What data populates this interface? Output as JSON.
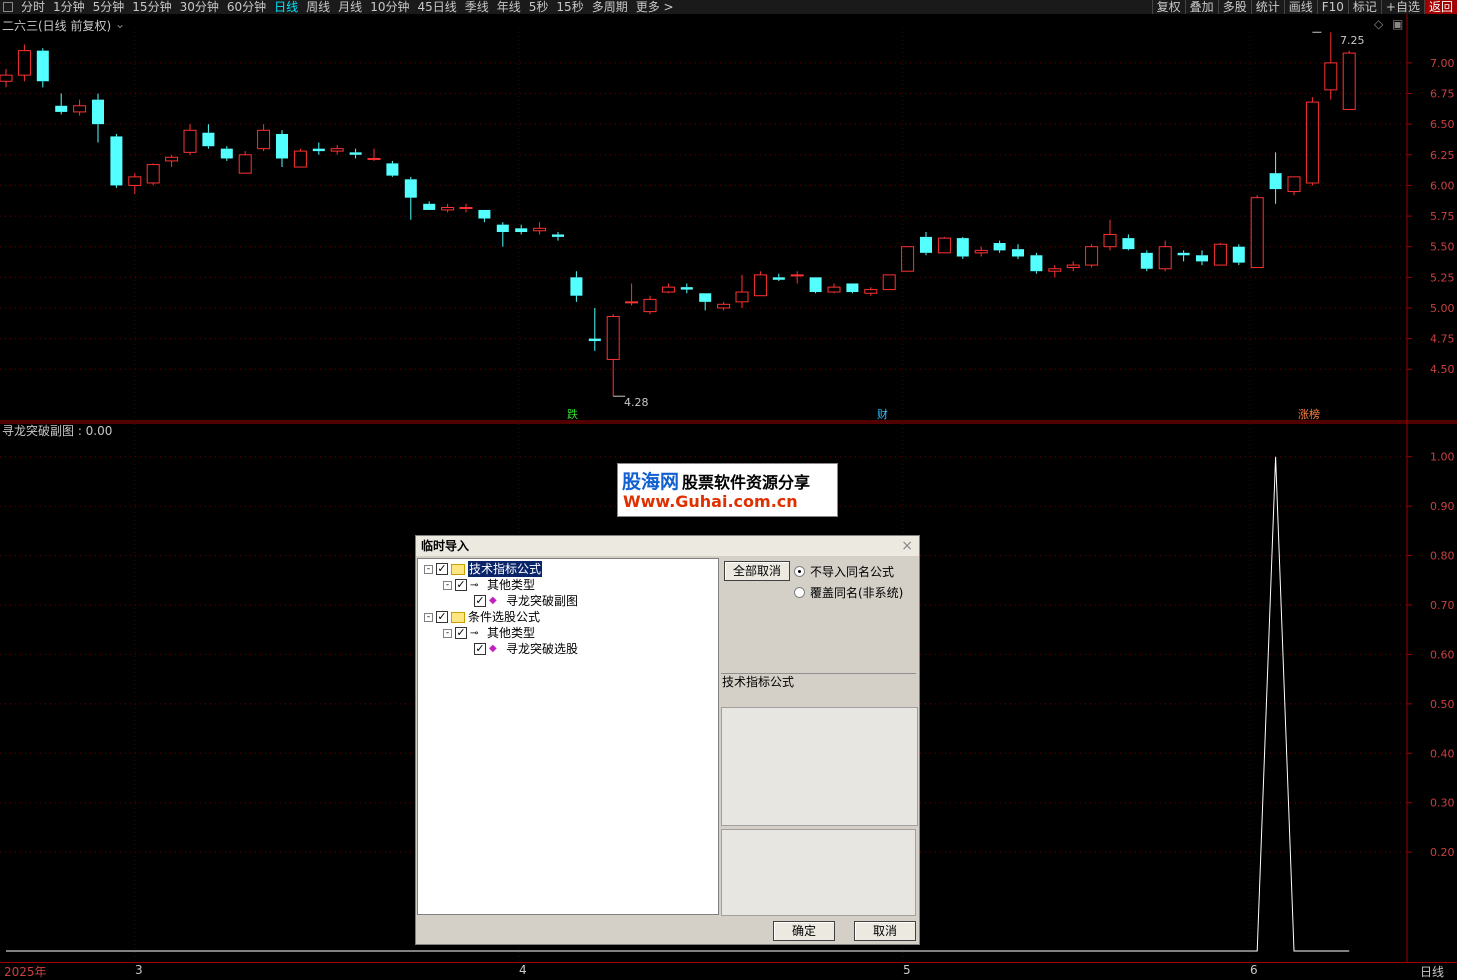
{
  "toolbar": {
    "periods": [
      "分时",
      "1分钟",
      "5分钟",
      "15分钟",
      "30分钟",
      "60分钟",
      "日线",
      "周线",
      "月线",
      "10分钟",
      "45日线",
      "季线",
      "年线",
      "5秒",
      "15秒",
      "多周期",
      "更多 >"
    ],
    "active": "日线",
    "right": [
      "复权",
      "叠加",
      "多股",
      "统计",
      "画线",
      "F10",
      "标记",
      "+自选",
      "返回"
    ]
  },
  "main_chart": {
    "title": "二六三(日线 前复权)",
    "high_label": "7.25",
    "low_label": "4.28",
    "event_labels": [
      "跌",
      "财",
      "涨榜"
    ]
  },
  "sub_chart": {
    "title": "寻龙突破副图 : 0.00"
  },
  "bottom_axis": {
    "labels": [
      "2025年",
      "3",
      "4",
      "5",
      "6"
    ],
    "period_label": "日线"
  },
  "watermark": {
    "cn": "股海网",
    "slogan": "股票软件资源分享",
    "url": "Www.Guhai.com.cn"
  },
  "dialog": {
    "title": "临时导入",
    "close": "×",
    "tree": [
      {
        "label": "技术指标公式",
        "level": 0,
        "type": "folder",
        "selected": true
      },
      {
        "label": "其他类型",
        "level": 1,
        "type": "key"
      },
      {
        "label": "寻龙突破副图",
        "level": 2,
        "type": "item"
      },
      {
        "label": "条件选股公式",
        "level": 0,
        "type": "folder"
      },
      {
        "label": "其他类型",
        "level": 1,
        "type": "key"
      },
      {
        "label": "寻龙突破选股",
        "level": 2,
        "type": "item"
      }
    ],
    "cancel_all": "全部取消",
    "radio1": "不导入同名公式",
    "radio2": "覆盖同名(非系统)",
    "section": "技术指标公式",
    "ok": "确定",
    "cancel": "取消"
  },
  "chart_data": [
    {
      "type": "candlestick",
      "title": "二六三(日线 前复权)",
      "ylim": [
        4.2,
        7.35
      ],
      "yticks": [
        4.5,
        4.75,
        5.0,
        5.25,
        5.5,
        5.75,
        6.0,
        6.25,
        6.5,
        6.75,
        7.0
      ],
      "ohlc": [
        [
          6.85,
          6.95,
          6.8,
          6.9
        ],
        [
          6.9,
          7.15,
          6.85,
          7.1
        ],
        [
          7.1,
          7.12,
          6.8,
          6.85
        ],
        [
          6.65,
          6.75,
          6.58,
          6.6
        ],
        [
          6.6,
          6.7,
          6.57,
          6.65
        ],
        [
          6.7,
          6.75,
          6.35,
          6.5
        ],
        [
          6.4,
          6.42,
          5.98,
          6.0
        ],
        [
          6.0,
          6.1,
          5.93,
          6.07
        ],
        [
          6.02,
          6.18,
          6.0,
          6.17
        ],
        [
          6.2,
          6.25,
          6.15,
          6.23
        ],
        [
          6.27,
          6.5,
          6.25,
          6.45
        ],
        [
          6.43,
          6.5,
          6.3,
          6.32
        ],
        [
          6.3,
          6.32,
          6.2,
          6.22
        ],
        [
          6.1,
          6.28,
          6.1,
          6.25
        ],
        [
          6.3,
          6.5,
          6.28,
          6.45
        ],
        [
          6.42,
          6.45,
          6.15,
          6.22
        ],
        [
          6.15,
          6.3,
          6.15,
          6.28
        ],
        [
          6.3,
          6.35,
          6.25,
          6.28
        ],
        [
          6.28,
          6.33,
          6.25,
          6.3
        ],
        [
          6.27,
          6.3,
          6.22,
          6.25
        ],
        [
          6.22,
          6.3,
          6.2,
          6.22
        ],
        [
          6.18,
          6.2,
          6.07,
          6.08
        ],
        [
          6.05,
          6.07,
          5.72,
          5.9
        ],
        [
          5.85,
          5.87,
          5.8,
          5.8
        ],
        [
          5.8,
          5.85,
          5.78,
          5.82
        ],
        [
          5.82,
          5.85,
          5.78,
          5.82
        ],
        [
          5.8,
          5.8,
          5.7,
          5.73
        ],
        [
          5.68,
          5.7,
          5.5,
          5.62
        ],
        [
          5.65,
          5.68,
          5.6,
          5.62
        ],
        [
          5.63,
          5.7,
          5.6,
          5.65
        ],
        [
          5.6,
          5.62,
          5.55,
          5.58
        ],
        [
          5.25,
          5.3,
          5.05,
          5.1
        ],
        [
          4.75,
          5.0,
          4.65,
          4.73
        ],
        [
          4.58,
          4.95,
          4.28,
          4.93
        ],
        [
          5.05,
          5.2,
          5.02,
          5.05
        ],
        [
          4.97,
          5.1,
          4.95,
          5.07
        ],
        [
          5.13,
          5.2,
          5.12,
          5.17
        ],
        [
          5.17,
          5.2,
          5.12,
          5.15
        ],
        [
          5.12,
          5.12,
          4.98,
          5.05
        ],
        [
          5.0,
          5.05,
          4.98,
          5.03
        ],
        [
          5.05,
          5.27,
          5.0,
          5.13
        ],
        [
          5.1,
          5.3,
          5.1,
          5.27
        ],
        [
          5.25,
          5.28,
          5.22,
          5.23
        ],
        [
          5.27,
          5.3,
          5.2,
          5.27
        ],
        [
          5.25,
          5.25,
          5.12,
          5.13
        ],
        [
          5.13,
          5.2,
          5.12,
          5.17
        ],
        [
          5.2,
          5.2,
          5.12,
          5.13
        ],
        [
          5.12,
          5.17,
          5.1,
          5.15
        ],
        [
          5.15,
          5.27,
          5.15,
          5.27
        ],
        [
          5.3,
          5.5,
          5.3,
          5.5
        ],
        [
          5.58,
          5.62,
          5.43,
          5.45
        ],
        [
          5.45,
          5.58,
          5.45,
          5.57
        ],
        [
          5.57,
          5.58,
          5.4,
          5.42
        ],
        [
          5.45,
          5.5,
          5.42,
          5.47
        ],
        [
          5.53,
          5.55,
          5.45,
          5.47
        ],
        [
          5.48,
          5.52,
          5.4,
          5.42
        ],
        [
          5.43,
          5.45,
          5.28,
          5.3
        ],
        [
          5.3,
          5.35,
          5.25,
          5.32
        ],
        [
          5.33,
          5.38,
          5.3,
          5.35
        ],
        [
          5.35,
          5.52,
          5.33,
          5.5
        ],
        [
          5.5,
          5.72,
          5.47,
          5.6
        ],
        [
          5.57,
          5.6,
          5.47,
          5.48
        ],
        [
          5.45,
          5.47,
          5.3,
          5.32
        ],
        [
          5.32,
          5.55,
          5.3,
          5.5
        ],
        [
          5.45,
          5.47,
          5.38,
          5.43
        ],
        [
          5.43,
          5.47,
          5.35,
          5.38
        ],
        [
          5.35,
          5.53,
          5.35,
          5.52
        ],
        [
          5.5,
          5.52,
          5.35,
          5.37
        ],
        [
          5.33,
          5.92,
          5.33,
          5.9
        ],
        [
          6.1,
          6.27,
          5.85,
          5.97
        ],
        [
          5.95,
          6.07,
          5.92,
          6.07
        ],
        [
          6.02,
          6.72,
          6.0,
          6.68
        ],
        [
          6.78,
          7.25,
          6.7,
          7.0
        ],
        [
          6.62,
          7.1,
          6.62,
          7.08
        ]
      ]
    },
    {
      "type": "line",
      "title": "寻龙突破副图",
      "ylim": [
        0,
        1.05
      ],
      "yticks": [
        0.2,
        0.3,
        0.4,
        0.5,
        0.6,
        0.7,
        0.8,
        0.9,
        1.0
      ],
      "x": [
        0,
        68,
        69,
        70,
        71,
        72
      ],
      "y": [
        0,
        0,
        1,
        0,
        0,
        0
      ]
    }
  ]
}
